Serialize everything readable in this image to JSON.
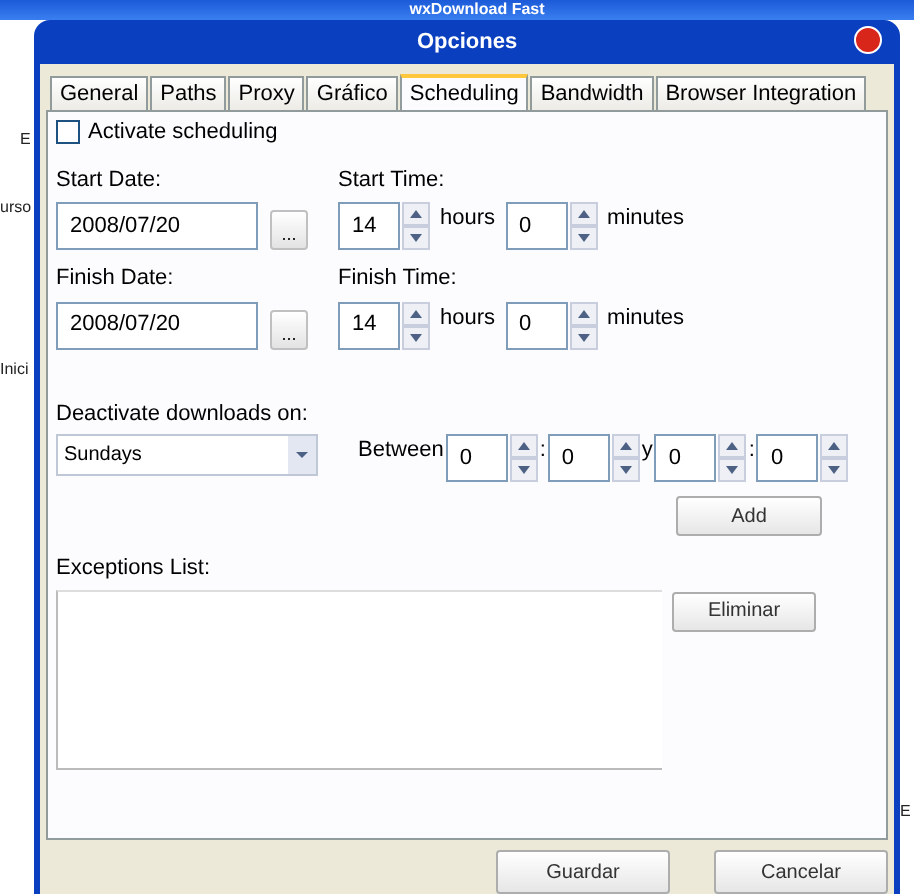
{
  "background_window": {
    "title": "wxDownload Fast",
    "fragments": [
      "E",
      "urso",
      "Inici",
      "E"
    ]
  },
  "dialog": {
    "title": "Opciones"
  },
  "tabs": [
    {
      "label": "General",
      "selected": false
    },
    {
      "label": "Paths",
      "selected": false
    },
    {
      "label": "Proxy",
      "selected": false
    },
    {
      "label": "Gráfico",
      "selected": false
    },
    {
      "label": "Scheduling",
      "selected": true
    },
    {
      "label": "Bandwidth",
      "selected": false
    },
    {
      "label": "Browser Integration",
      "selected": false
    }
  ],
  "activate_scheduling": {
    "label": "Activate scheduling",
    "checked": false
  },
  "start": {
    "date_label": "Start Date:",
    "date": "2008/07/20",
    "date_button": "...",
    "time_label": "Start Time:",
    "hours": "14",
    "hours_label": "hours",
    "minutes": "0",
    "minutes_label": "minutes"
  },
  "finish": {
    "date_label": "Finish Date:",
    "date": "2008/07/20",
    "date_button": "...",
    "time_label": "Finish Time:",
    "hours": "14",
    "hours_label": "hours",
    "minutes": "0",
    "minutes_label": "minutes"
  },
  "deactivate": {
    "label": "Deactivate downloads on:",
    "day": "Sundays",
    "between_label": "Between",
    "from_hours": "0",
    "from_sep": ":",
    "from_minutes": "0",
    "and_label": "y",
    "to_hours": "0",
    "to_sep": ":",
    "to_minutes": "0",
    "add_button": "Add"
  },
  "exceptions": {
    "label": "Exceptions List:",
    "remove_button": "Eliminar"
  },
  "buttons": [
    "Guardar",
    "Cancelar"
  ]
}
